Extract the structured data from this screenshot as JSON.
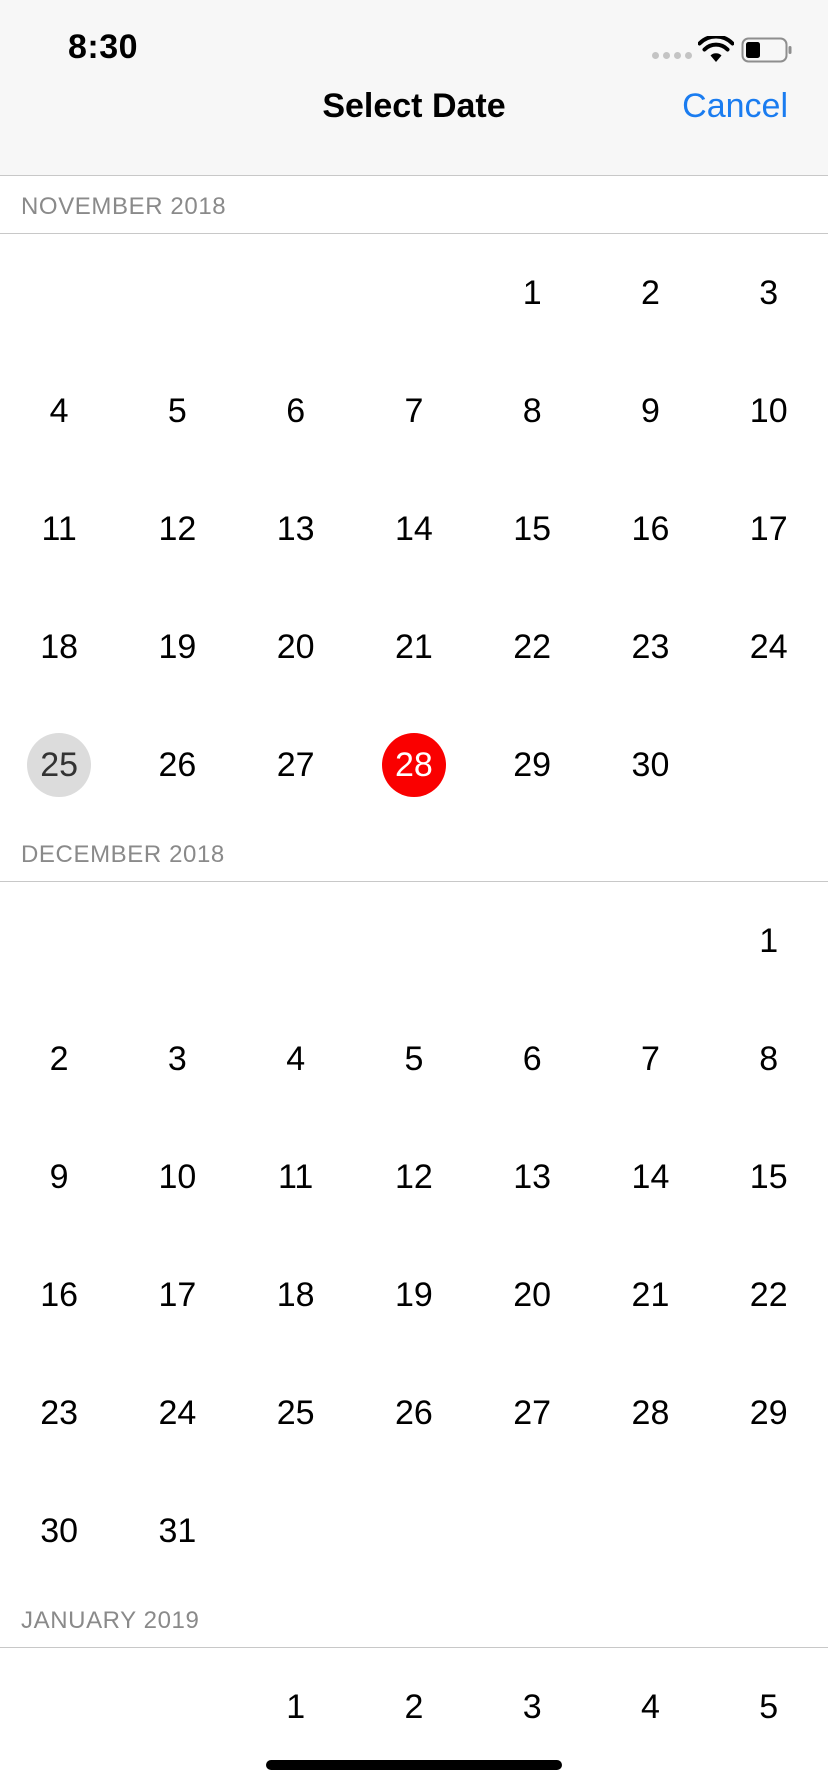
{
  "status_bar": {
    "time": "8:30"
  },
  "navigation": {
    "title": "Select Date",
    "cancel_label": "Cancel"
  },
  "colors": {
    "accent": "#1a7cf0",
    "selected": "#fa0000",
    "today": "#dcdcdc"
  },
  "months": [
    {
      "title": "NOVEMBER 2018",
      "leading_blanks": 4,
      "days": [
        "1",
        "2",
        "3",
        "4",
        "5",
        "6",
        "7",
        "8",
        "9",
        "10",
        "11",
        "12",
        "13",
        "14",
        "15",
        "16",
        "17",
        "18",
        "19",
        "20",
        "21",
        "22",
        "23",
        "24",
        "25",
        "26",
        "27",
        "28",
        "29",
        "30"
      ],
      "today": "25",
      "selected": "28"
    },
    {
      "title": "DECEMBER 2018",
      "leading_blanks": 6,
      "days": [
        "1",
        "2",
        "3",
        "4",
        "5",
        "6",
        "7",
        "8",
        "9",
        "10",
        "11",
        "12",
        "13",
        "14",
        "15",
        "16",
        "17",
        "18",
        "19",
        "20",
        "21",
        "22",
        "23",
        "24",
        "25",
        "26",
        "27",
        "28",
        "29",
        "30",
        "31"
      ]
    },
    {
      "title": "JANUARY 2019",
      "leading_blanks": 2,
      "days": [
        "1",
        "2",
        "3",
        "4",
        "5"
      ]
    }
  ]
}
